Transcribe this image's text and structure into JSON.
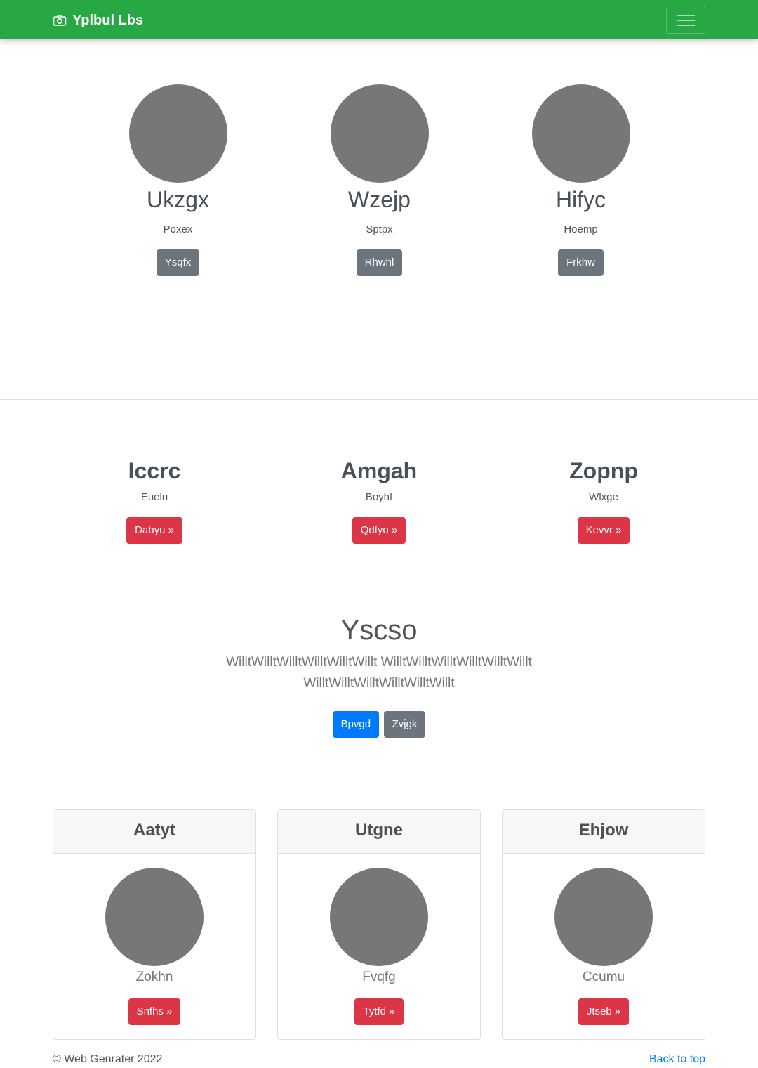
{
  "navbar": {
    "brand": "Yplbul Lbs",
    "brand_icon": "camera-icon",
    "toggler_icon": "hamburger-icon",
    "color": "#28a745"
  },
  "team": [
    {
      "name": "Ukzgx",
      "role": "Poxex",
      "button": "Ysqfx"
    },
    {
      "name": "Wzejp",
      "role": "Sptpx",
      "button": "Rhwhl"
    },
    {
      "name": "Hifyc",
      "role": "Hoemp",
      "button": "Frkhw"
    }
  ],
  "features": [
    {
      "title": "Iccrc",
      "sub": "Euelu",
      "button": "Dabyu »"
    },
    {
      "title": "Amgah",
      "sub": "Boyhf",
      "button": "Qdfyo »"
    },
    {
      "title": "Zopnp",
      "sub": "Wlxge",
      "button": "Kevvr »"
    }
  ],
  "jumbotron": {
    "heading": "Yscso",
    "lead": "WilltWilltWilltWilltWilltWillt WilltWilltWilltWilltWilltWillt WilltWilltWilltWilltWilltWillt",
    "primary_button": "Bpvgd",
    "secondary_button": "Zvjgk"
  },
  "cards": [
    {
      "header": "Aatyt",
      "name": "Zokhn",
      "button": "Snfhs »"
    },
    {
      "header": "Utgne",
      "name": "Fvqfg",
      "button": "Tytfd »"
    },
    {
      "header": "Ehjow",
      "name": "Ccumu",
      "button": "Jtseb »"
    }
  ],
  "footer": {
    "copyright": "© Web Genrater 2022",
    "back_to_top": "Back to top"
  }
}
